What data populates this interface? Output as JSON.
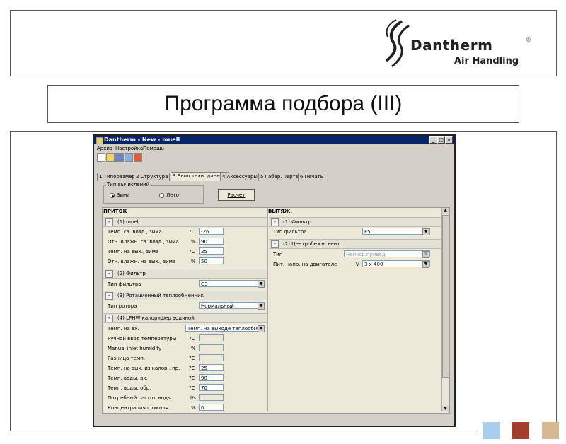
{
  "header": {
    "brand_name": "Dantherm",
    "registered": "®",
    "brand_tagline": "Air Handling"
  },
  "slide_title": "Программа подбора (III)",
  "app": {
    "window_title": "Dantherm - New - muell",
    "window_controls": [
      "_",
      "□",
      "x"
    ],
    "menu": [
      "Архив",
      "Настройка",
      "Помощь"
    ],
    "tabs": [
      "1 Типоразмер",
      "2 Структура",
      "3 Ввод техн. данных",
      "4 Аксессуары",
      "5 Габар. чертеж",
      "6 Печать"
    ],
    "calc_type": {
      "legend": "Тип вычислений",
      "options": [
        "Зима",
        "Лето"
      ],
      "selected": "Зима"
    },
    "calc_button": "Расчет",
    "supply": {
      "heading": "ПРИТОК",
      "groups": [
        {
          "title": "(1) muell",
          "rows": [
            {
              "label": "Темп. св. возд., зима",
              "unit": "?C",
              "value": "-26"
            },
            {
              "label": "Отн. влажн. св. возд., зима",
              "unit": "%",
              "value": "90"
            },
            {
              "label": "Темп. на вых., зима",
              "unit": "?C",
              "value": "25"
            },
            {
              "label": "Отн. влажн. на вых., зима",
              "unit": "%",
              "value": "50"
            }
          ]
        },
        {
          "title": "(2) Фильтр",
          "rows": [
            {
              "label": "Тип фильтра",
              "unit": "",
              "value": "G3"
            }
          ]
        },
        {
          "title": "(3) Ротационный теплообменник",
          "rows": [
            {
              "label": "Тип ротора",
              "unit": "",
              "value": "Нормальный"
            }
          ]
        },
        {
          "title": "(4) LPHW калорифер водяной",
          "rows": [
            {
              "label": "Темп. на вх.",
              "unit": "",
              "value": "Темп. на выходе теплообм."
            },
            {
              "label": "Ручной ввод температуры",
              "unit": "?C",
              "value": ""
            },
            {
              "label": "Manual inlet humidity",
              "unit": "%",
              "value": ""
            },
            {
              "label": "Разница темп.",
              "unit": "?C",
              "value": ""
            },
            {
              "label": "Темп. на вых. из калор., пр.",
              "unit": "?C",
              "value": "25"
            },
            {
              "label": "Темп. воды, вх.",
              "unit": "?C",
              "value": "90"
            },
            {
              "label": "Темп. воды, обр.",
              "unit": "?C",
              "value": "70"
            },
            {
              "label": "Потребный расход воды",
              "unit": "l/s",
              "value": ""
            },
            {
              "label": "Концентрация гликоля",
              "unit": "%",
              "value": "0"
            }
          ]
        }
      ]
    },
    "exhaust": {
      "heading": "ВЫТЯЖ.",
      "groups": [
        {
          "title": "(1) Фильтр",
          "rows": [
            {
              "label": "Тип фильтра",
              "unit": "",
              "value": "F5"
            }
          ]
        },
        {
          "title": "(2) Центробежн. вент.",
          "rows": [
            {
              "label": "Тип",
              "unit": "",
              "value": "Непоср.привод"
            },
            {
              "label": "Пит. напр. на двигателе",
              "unit": "V",
              "value": "3 x 400"
            }
          ]
        }
      ]
    }
  },
  "colors": {
    "square_1": "#a9cdec",
    "square_2": "#a33d2b",
    "square_3": "#d7b892",
    "titlebar": "#0a246a"
  }
}
